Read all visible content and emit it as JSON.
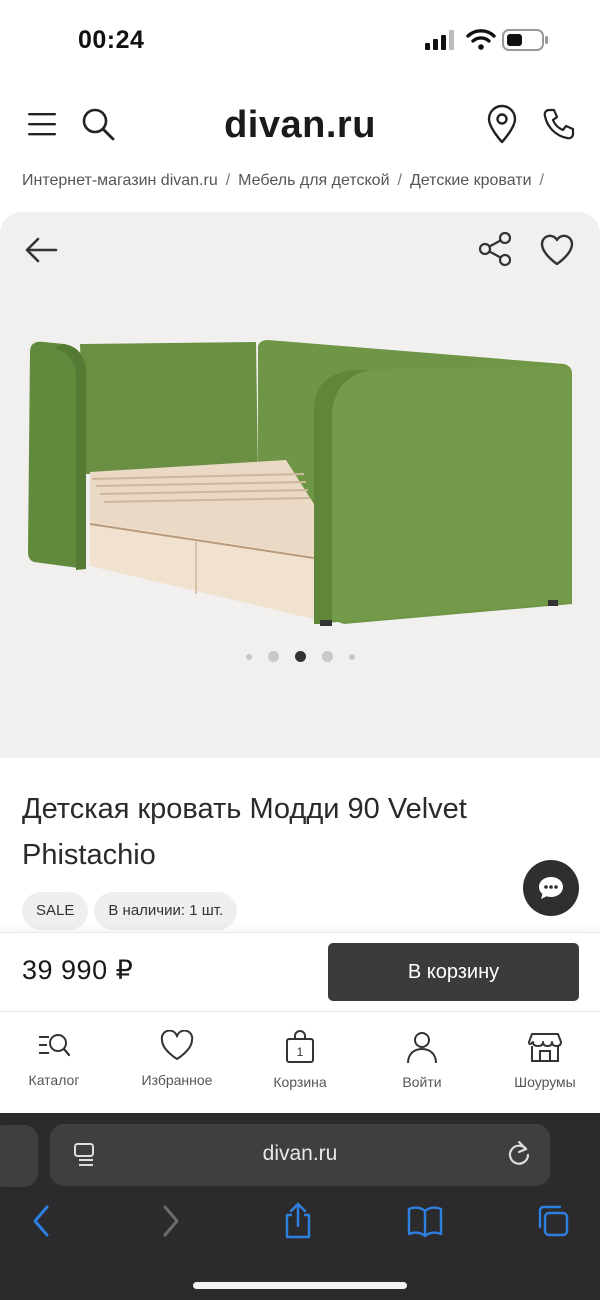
{
  "status_bar": {
    "time": "00:24"
  },
  "header": {
    "logo": "divan.ru"
  },
  "breadcrumbs": [
    "Интернет-магазин divan.ru",
    "Мебель для детской",
    "Детские кровати"
  ],
  "gallery": {
    "image_count": 5,
    "active_index": 2
  },
  "product": {
    "title": "Детская кровать Модди 90 Velvet Phistachio",
    "badges": [
      "SALE",
      "В наличии: 1 шт."
    ],
    "price": "39 990 ₽",
    "cart_button": "В корзину"
  },
  "bottom_nav": [
    {
      "label": "Каталог",
      "icon": "catalog-search-icon"
    },
    {
      "label": "Избранное",
      "icon": "heart-icon"
    },
    {
      "label": "Корзина",
      "icon": "bag-icon",
      "count": "1"
    },
    {
      "label": "Войти",
      "icon": "user-icon"
    },
    {
      "label": "Шоурумы",
      "icon": "store-icon"
    }
  ],
  "browser": {
    "url": "divan.ru"
  },
  "colors": {
    "accent_dark": "#3b3b3b",
    "gallery_bg": "#f1f0ef",
    "bed_green": "#6e9446",
    "safari_bg": "#2b2b2d",
    "link_blue": "#2f7fe0"
  }
}
